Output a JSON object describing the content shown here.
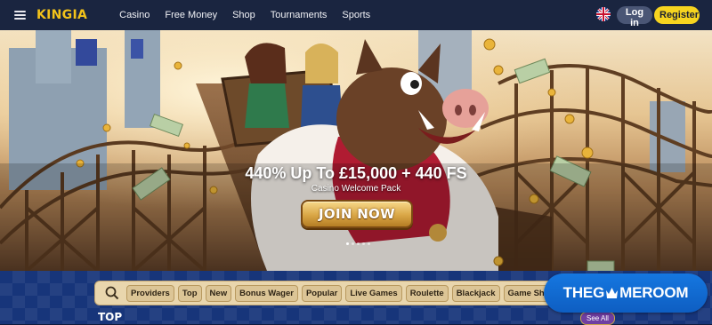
{
  "header": {
    "logo": "KINGIA",
    "nav": [
      "Casino",
      "Free Money",
      "Shop",
      "Tournaments",
      "Sports"
    ],
    "login_label": "Log in",
    "register_label": "Register",
    "icons": {
      "menu": "hamburger-menu-icon",
      "language": "uk-flag-icon"
    },
    "colors": {
      "bar": "#1a2540",
      "logo": "#f2c21a",
      "register": "#f6d41f",
      "login": "#4a5675"
    }
  },
  "hero": {
    "headline": "440% Up To £15,000 + 440 FS",
    "subheadline": "Casino Welcome Pack",
    "cta_label": "JOIN NOW",
    "slides": 5,
    "active_slide": 1
  },
  "filters": {
    "search_icon": "search-icon",
    "chips": [
      "Providers",
      "Top",
      "New",
      "Bonus Wager",
      "Popular",
      "Live Games",
      "Roulette",
      "Blackjack",
      "Game Shows"
    ]
  },
  "section": {
    "title": "TOP",
    "see_all_label": "See All"
  },
  "watermark": {
    "before": "THEG",
    "after": "ME",
    "last": "ROOM"
  }
}
